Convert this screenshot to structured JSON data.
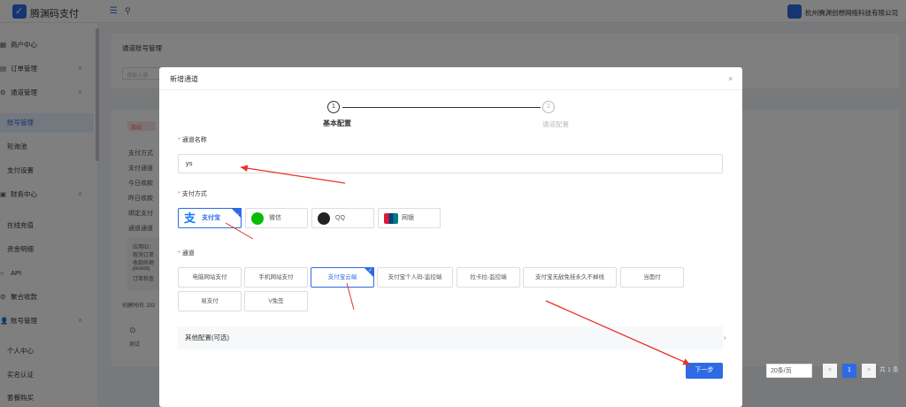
{
  "app": {
    "brand": "腾渊码支付",
    "company": "杭州腾渊创想网络科技有限公司"
  },
  "sidebar": {
    "items": [
      {
        "label": "商户中心",
        "icon": "grid-icon",
        "glyph": "▦",
        "expandable": false
      },
      {
        "label": "订单管理",
        "icon": "doc-icon",
        "glyph": "▤",
        "expandable": true
      },
      {
        "label": "通道管理",
        "icon": "settings-icon",
        "glyph": "⚙",
        "expandable": true
      },
      {
        "label": "财务中心",
        "icon": "wallet-icon",
        "glyph": "▣",
        "expandable": true
      },
      {
        "label": "API",
        "icon": "api-icon",
        "glyph": "○",
        "expandable": false
      },
      {
        "label": "聚合收款",
        "icon": "gear-icon",
        "glyph": "⚙",
        "expandable": false
      },
      {
        "label": "账号管理",
        "icon": "user-icon",
        "glyph": "👤",
        "expandable": true
      }
    ],
    "subitems": [
      {
        "label": "账号管理",
        "active": true
      },
      {
        "label": "轮询池",
        "active": false
      },
      {
        "label": "支付设置",
        "active": false
      },
      {
        "label": "在线充值",
        "active": false
      },
      {
        "label": "资金明细",
        "active": false
      },
      {
        "label": "个人中心",
        "active": false
      },
      {
        "label": "实名认证",
        "active": false
      },
      {
        "label": "套餐购买",
        "active": false
      }
    ]
  },
  "background": {
    "title": "通道账号管理",
    "search_placeholder": "请输入通",
    "status_badge": "离线",
    "field_labels": [
      "支付方式",
      "支付通道",
      "今日收款",
      "昨日收款",
      "绑定支付",
      "通道通道"
    ],
    "code_lines": [
      "应用ID：",
      "取消订单",
      "收款码地",
      "pkskdq",
      "订单检查"
    ],
    "created_label": "创建时间: 202",
    "test_label": "测试"
  },
  "pagination": {
    "page_size": "20条/页",
    "current_page": "1",
    "total": "共 1 条",
    "prev": "<",
    "next": ">"
  },
  "modal": {
    "title": "新增通道",
    "close": "×",
    "steps": [
      {
        "number": "1",
        "label": "基本配置",
        "active": true
      },
      {
        "number": "2",
        "label": "通道配置",
        "active": false
      }
    ],
    "name_field": {
      "label": "通道名称",
      "value": "ys"
    },
    "payment_method": {
      "label": "支付方式",
      "options": [
        {
          "label": "支付宝",
          "icon": "alipay-icon",
          "selected": true
        },
        {
          "label": "微信",
          "icon": "wechat-icon",
          "selected": false
        },
        {
          "label": "QQ",
          "icon": "qq-icon",
          "selected": false
        },
        {
          "label": "网银",
          "icon": "unionpay-icon",
          "selected": false
        }
      ]
    },
    "channel": {
      "label": "通道",
      "options": [
        {
          "label": "电脑网站支付",
          "selected": false
        },
        {
          "label": "手机网站支付",
          "selected": false
        },
        {
          "label": "支付宝云端",
          "selected": true
        },
        {
          "label": "支付宝个人码-监控端",
          "selected": false
        },
        {
          "label": "拉卡拉-监控端",
          "selected": false
        },
        {
          "label": "支付宝无敌免挂永久不掉线",
          "selected": false
        },
        {
          "label": "当面付",
          "selected": false
        },
        {
          "label": "易支付",
          "selected": false
        },
        {
          "label": "V免签",
          "selected": false
        }
      ]
    },
    "other_config": "其他配置(可选)",
    "next_button": "下一步"
  },
  "colors": {
    "primary": "#2d6be4",
    "required": "#f56c6c",
    "annotation": "#e8312a"
  }
}
